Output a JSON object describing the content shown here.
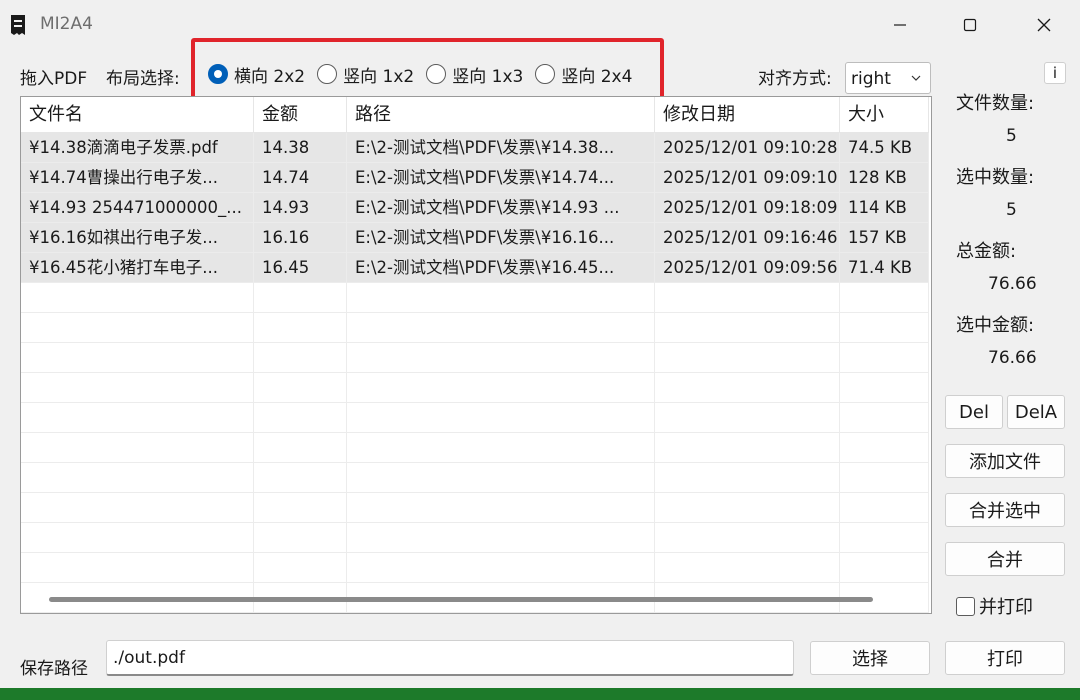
{
  "window": {
    "title": "MI2A4"
  },
  "toolbar": {
    "drop_label": "拖入PDF",
    "layout_label": "布局选择:",
    "layout_options": [
      {
        "label": "横向 2x2",
        "selected": true
      },
      {
        "label": "竖向 1x2",
        "selected": false
      },
      {
        "label": "竖向 1x3",
        "selected": false
      },
      {
        "label": "竖向 2x4",
        "selected": false
      }
    ],
    "align_label": "对齐方式:",
    "align_value": "right",
    "info_label": "i"
  },
  "table": {
    "columns": [
      "文件名",
      "金额",
      "路径",
      "修改日期",
      "大小"
    ],
    "rows": [
      {
        "name": "¥14.38滴滴电子发票.pdf",
        "amount": "14.38",
        "path": "E:\\2-测试文档\\PDF\\发票\\¥14.38...",
        "date": "2025/12/01 09:10:28",
        "size": "74.5 KB"
      },
      {
        "name": "¥14.74曹操出行电子发...",
        "amount": "14.74",
        "path": "E:\\2-测试文档\\PDF\\发票\\¥14.74...",
        "date": "2025/12/01 09:09:10",
        "size": "128 KB"
      },
      {
        "name": "¥14.93   254471000000_...",
        "amount": "14.93",
        "path": "E:\\2-测试文档\\PDF\\发票\\¥14.93   ...",
        "date": "2025/12/01 09:18:09",
        "size": "114 KB"
      },
      {
        "name": "¥16.16如祺出行电子发...",
        "amount": "16.16",
        "path": "E:\\2-测试文档\\PDF\\发票\\¥16.16...",
        "date": "2025/12/01 09:16:46",
        "size": "157 KB"
      },
      {
        "name": "¥16.45花小猪打车电子...",
        "amount": "16.45",
        "path": "E:\\2-测试文档\\PDF\\发票\\¥16.45...",
        "date": "2025/12/01 09:09:56",
        "size": "71.4 KB"
      }
    ]
  },
  "stats": {
    "file_count_label": "文件数量:",
    "file_count": "5",
    "selected_count_label": "选中数量:",
    "selected_count": "5",
    "total_amount_label": "总金额:",
    "total_amount": "76.66",
    "selected_amount_label": "选中金额:",
    "selected_amount": "76.66"
  },
  "actions": {
    "del": "Del",
    "dela": "DelA",
    "add_files": "添加文件",
    "merge_selected": "合并选中",
    "merge": "合并",
    "print_checkbox": "并打印",
    "print_checked": false
  },
  "bottom": {
    "save_label": "保存路径",
    "save_path": "./out.pdf",
    "choose": "选择",
    "print": "打印"
  },
  "colors": {
    "accent": "#005fb8",
    "highlight_box": "#e0242b",
    "row_fill": "#e6e6e6"
  }
}
